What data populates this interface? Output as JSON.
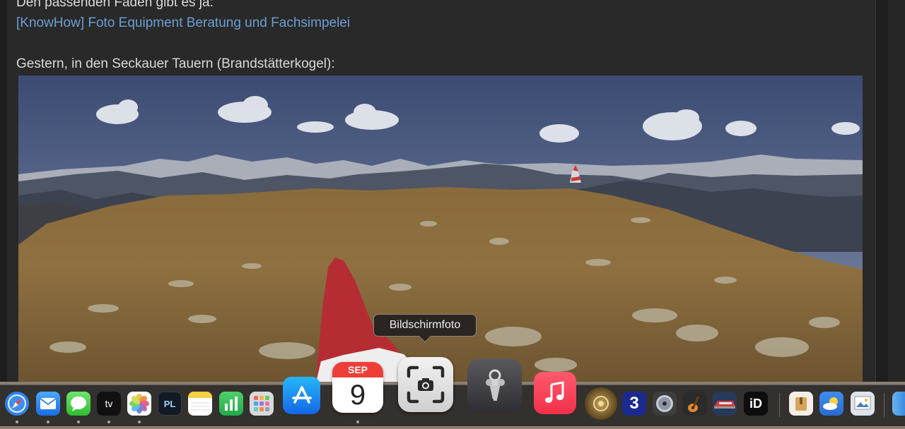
{
  "post": {
    "line1": "Den passenden Faden gibt es ja:",
    "link_text": "[KnowHow] Foto Equipment Beratung und Fachsimpelei",
    "line3": "Gestern, in den Seckauer Tauern (Brandstätterkogel):"
  },
  "tooltip": {
    "label": "Bildschirmfoto"
  },
  "dock": {
    "calendar": {
      "month": "SEP",
      "day": "9"
    },
    "tv_label": "tv",
    "dxo_label": "PL",
    "channel3_label": "3",
    "id_label": "iD",
    "apps": [
      "Safari",
      "Mail",
      "Messages",
      "TV",
      "Photos",
      "DxO PhotoLab",
      "Notes",
      "Numbers",
      "Launchpad",
      "App Store",
      "Calendar",
      "Screenshot",
      "Keychain Access",
      "Music",
      "Theater app",
      "Channel 3",
      "Disk app",
      "GarageBand",
      "Train app",
      "iD app",
      "Archive Utility",
      "Weather",
      "Preview",
      "Finder"
    ],
    "running_apps": [
      "Safari",
      "Mail",
      "Messages",
      "TV",
      "Photos",
      "Calendar"
    ]
  },
  "colors": {
    "link": "#6b9fd3",
    "text": "#d9d9d9",
    "page_background": "#292929",
    "dock_background": "#2c2a28",
    "tooltip_background": "#2b2522"
  }
}
